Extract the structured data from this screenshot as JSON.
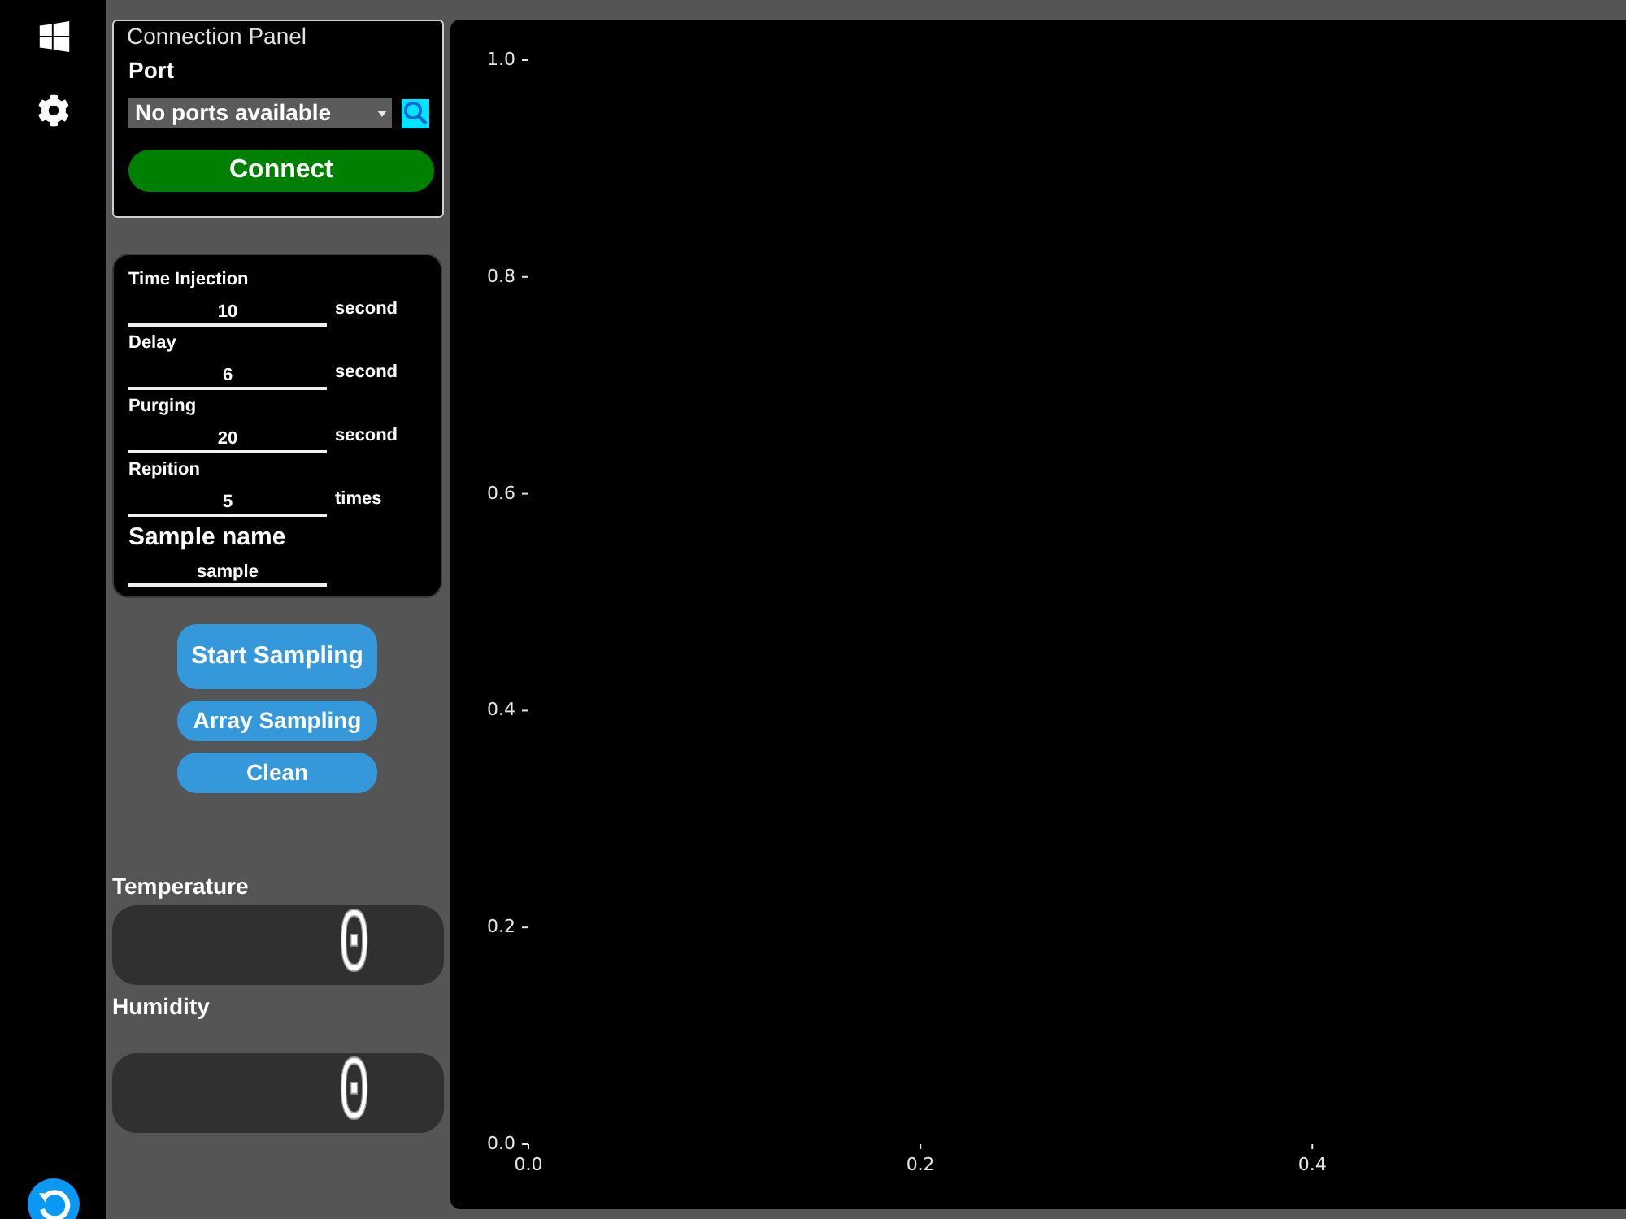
{
  "connection_panel": {
    "title": "Connection Panel",
    "port_label": "Port",
    "port_select": {
      "value": "No ports available"
    },
    "connect_button": "Connect"
  },
  "parameters": {
    "fields": [
      {
        "label": "Time Injection",
        "value": "10",
        "unit": "second"
      },
      {
        "label": "Delay",
        "value": "6",
        "unit": "second"
      },
      {
        "label": "Purging",
        "value": "20",
        "unit": "second"
      },
      {
        "label": "Repition",
        "value": "5",
        "unit": "times"
      }
    ],
    "sample_name": {
      "label": "Sample name",
      "value": "sample"
    }
  },
  "actions": [
    {
      "label": "Start Sampling",
      "kind": "primary"
    },
    {
      "label": "Array Sampling",
      "kind": "secondary"
    },
    {
      "label": "Clean",
      "kind": "secondary"
    }
  ],
  "readouts": [
    {
      "label": "Temperature",
      "value": "0"
    },
    {
      "label": "Humidity",
      "value": "0"
    }
  ],
  "chart": {
    "chart_data": {
      "type": "line",
      "xlim": [
        0,
        0.56
      ],
      "ylim": [
        0,
        1
      ],
      "xticks": [
        {
          "value": 0,
          "label": "0.0"
        },
        {
          "value": 0.2,
          "label": "0.2"
        },
        {
          "value": 0.4,
          "label": "0.4"
        }
      ],
      "yticks": [
        {
          "value": 0,
          "label": "0.0"
        },
        {
          "value": 0.2,
          "label": "0.2"
        },
        {
          "value": 0.4,
          "label": "0.4"
        },
        {
          "value": 0.6,
          "label": "0.6"
        },
        {
          "value": 0.8,
          "label": "0.8"
        },
        {
          "value": 1,
          "label": "1.0"
        }
      ]
    }
  }
}
